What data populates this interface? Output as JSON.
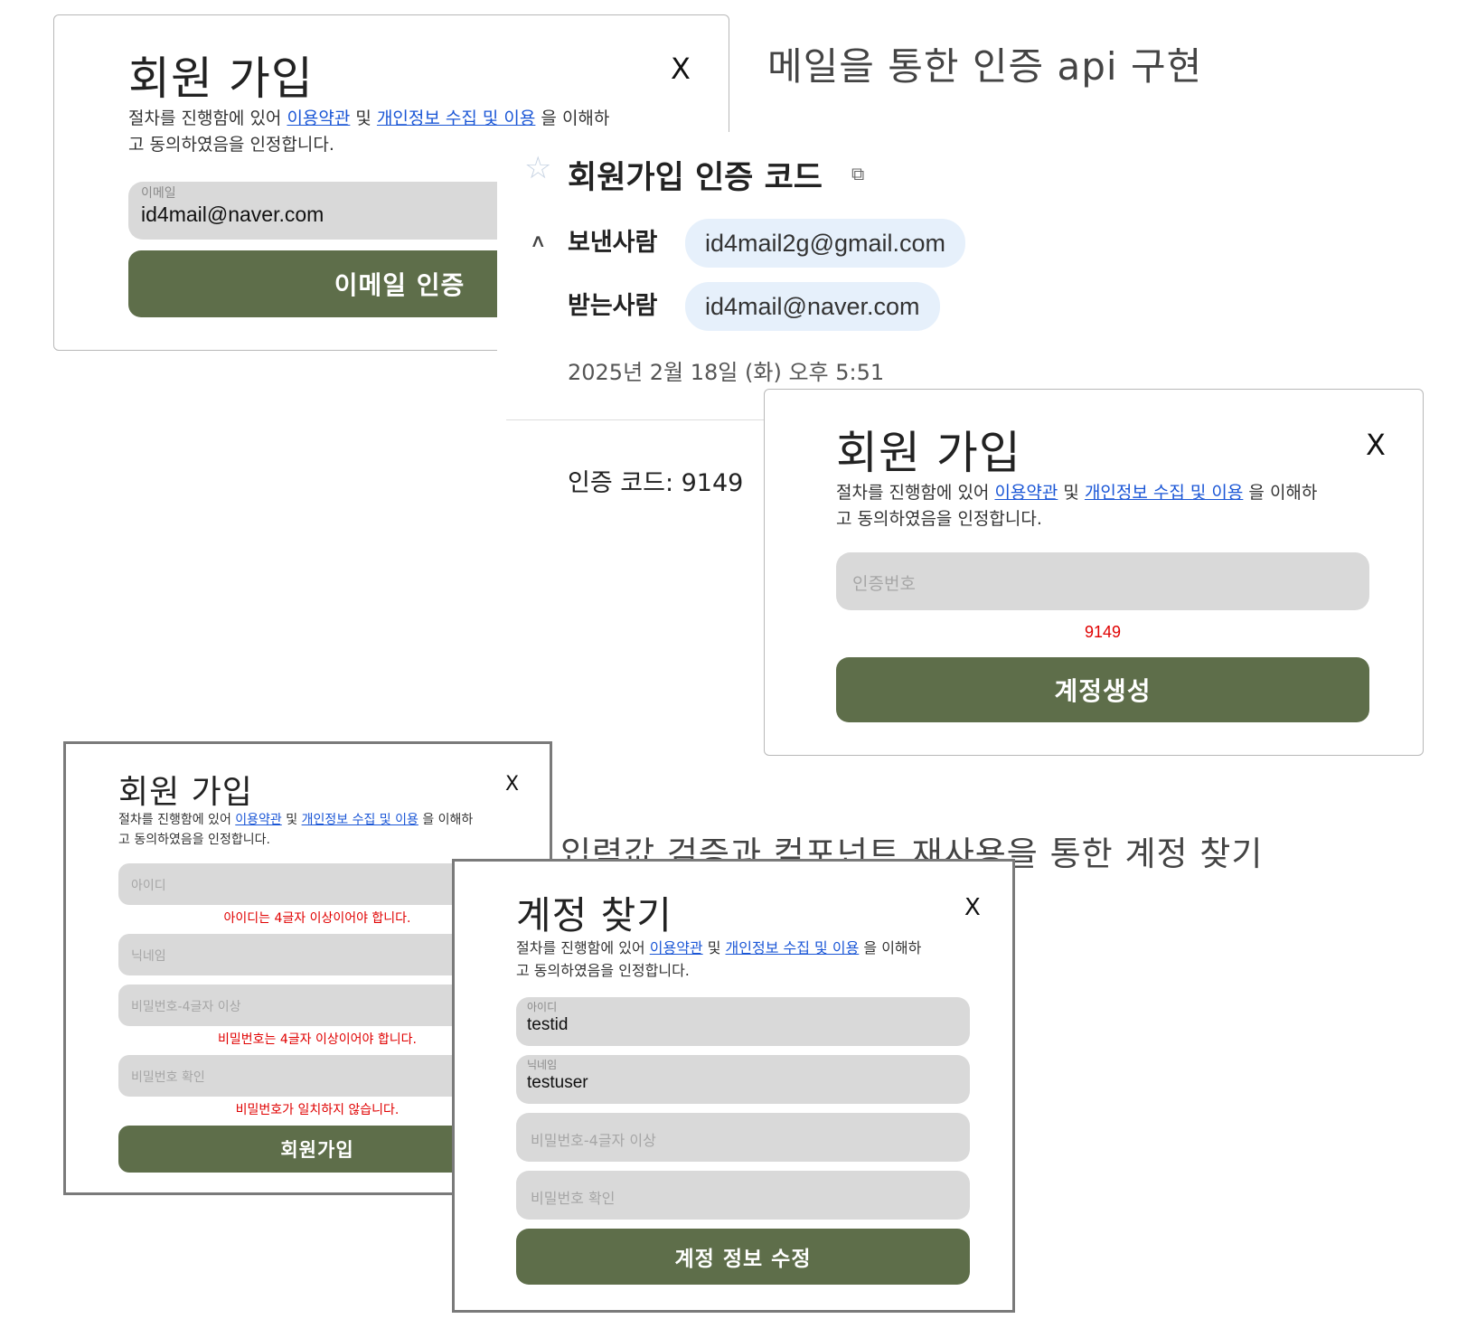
{
  "headings": {
    "email_api": "메일을 통한 인증 api 구현",
    "find_account": "입력값 검증과 컴포넌트 재사용을 통한 계정 찾기"
  },
  "common": {
    "close": "X",
    "desc_prefix": "절차를 진행함에 있어 ",
    "terms_link": "이용약관",
    "desc_and": " 및 ",
    "privacy_link": "개인정보 수집 및 이용",
    "desc_suffix_line1": " 을 이해하",
    "desc_line2": "고 동의하였음을 인정합니다."
  },
  "signup_email": {
    "title": "회원 가입",
    "email_label": "이메일",
    "email_value": "id4mail@naver.com",
    "verify_button": "이메일 인증"
  },
  "email_view": {
    "subject": "회원가입 인증 코드",
    "sender_label": "보낸사람",
    "sender": "id4mail2g@gmail.com",
    "recipient_label": "받는사람",
    "recipient": "id4mail@naver.com",
    "date": "2025년 2월 18일 (화) 오후 5:51",
    "body": "인증 코드: 9149"
  },
  "signup_code": {
    "title": "회원 가입",
    "code_placeholder": "인증번호",
    "code_hint": "9149",
    "create_button": "계정생성"
  },
  "signup_validate": {
    "title": "회원 가입",
    "id_placeholder": "아이디",
    "id_error": "아이디는 4글자 이상이어야 합니다.",
    "nick_placeholder": "닉네임",
    "pw_placeholder": "비밀번호-4글자 이상",
    "pw_error": "비밀번호는 4글자 이상이어야 합니다.",
    "pw_confirm_placeholder": "비밀번호 확인",
    "pw_confirm_error": "비밀번호가 일치하지 않습니다.",
    "submit_button": "회원가입"
  },
  "find_account": {
    "title": "계정 찾기",
    "id_label": "아이디",
    "id_value": "testid",
    "nick_label": "닉네임",
    "nick_value": "testuser",
    "pw_placeholder": "비밀번호-4글자 이상",
    "pw_confirm_placeholder": "비밀번호 확인",
    "submit_button": "계정 정보 수정"
  }
}
